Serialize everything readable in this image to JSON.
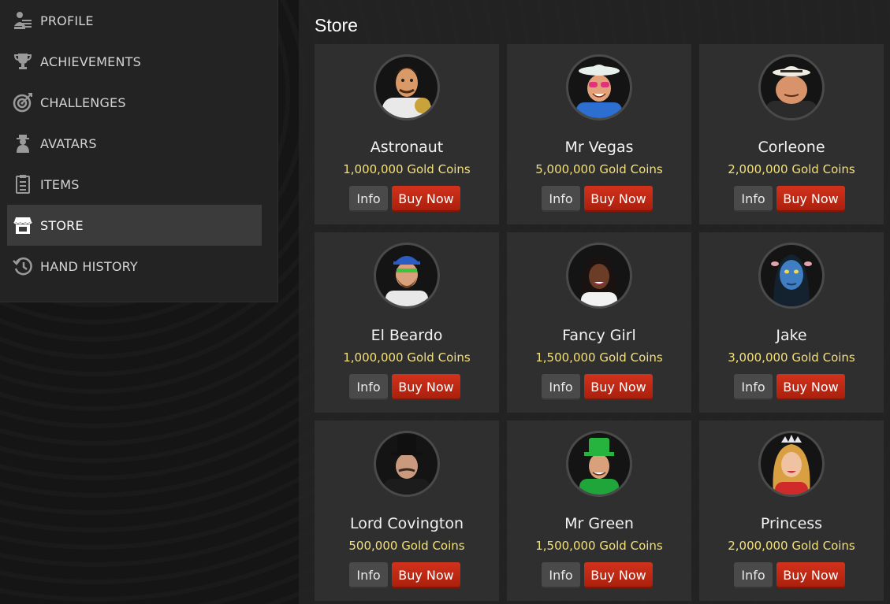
{
  "sidebar": {
    "items": [
      {
        "label": "PROFILE",
        "icon": "profile-icon",
        "active": false
      },
      {
        "label": "ACHIEVEMENTS",
        "icon": "trophy-icon",
        "active": false
      },
      {
        "label": "CHALLENGES",
        "icon": "target-icon",
        "active": false
      },
      {
        "label": "AVATARS",
        "icon": "avatar-icon",
        "active": false
      },
      {
        "label": "ITEMS",
        "icon": "clipboard-icon",
        "active": false
      },
      {
        "label": "STORE",
        "icon": "store-icon",
        "active": true
      },
      {
        "label": "HAND HISTORY",
        "icon": "history-icon",
        "active": false
      }
    ]
  },
  "main": {
    "title": "Store",
    "info_label": "Info",
    "buy_label": "Buy Now",
    "products": [
      {
        "name": "Astronaut",
        "price": "1,000,000 Gold Coins",
        "avatar": "astronaut-avatar"
      },
      {
        "name": "Mr Vegas",
        "price": "5,000,000 Gold Coins",
        "avatar": "mr-vegas-avatar"
      },
      {
        "name": "Corleone",
        "price": "2,000,000 Gold Coins",
        "avatar": "corleone-avatar"
      },
      {
        "name": "El Beardo",
        "price": "1,000,000 Gold Coins",
        "avatar": "el-beardo-avatar"
      },
      {
        "name": "Fancy Girl",
        "price": "1,500,000 Gold Coins",
        "avatar": "fancy-girl-avatar"
      },
      {
        "name": "Jake",
        "price": "3,000,000 Gold Coins",
        "avatar": "jake-avatar"
      },
      {
        "name": "Lord Covington",
        "price": "500,000 Gold Coins",
        "avatar": "lord-covington-avatar"
      },
      {
        "name": "Mr Green",
        "price": "1,500,000 Gold Coins",
        "avatar": "mr-green-avatar"
      },
      {
        "name": "Princess",
        "price": "2,000,000 Gold Coins",
        "avatar": "princess-avatar"
      }
    ]
  },
  "colors": {
    "price": "#f3e07a",
    "buy_button": "#c42a16",
    "sidebar_active": "#3b3b3b"
  }
}
